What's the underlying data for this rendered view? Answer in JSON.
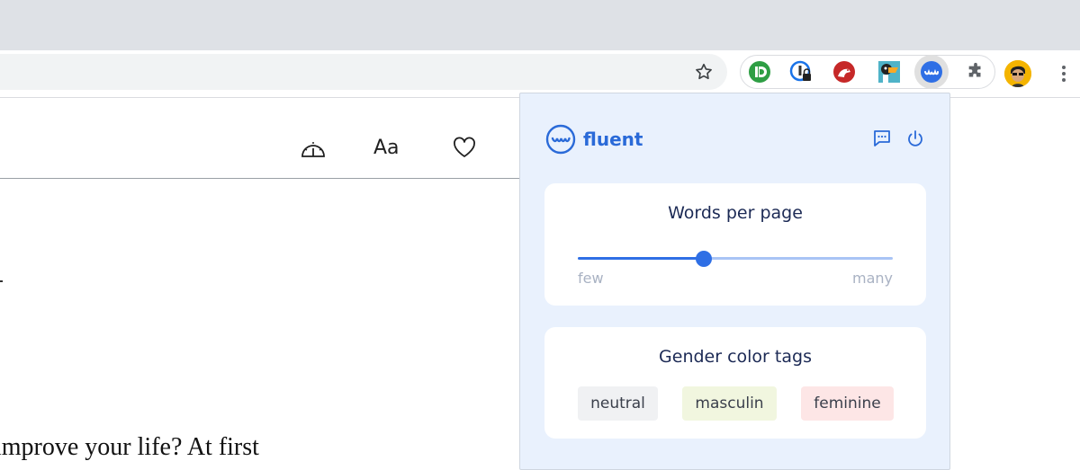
{
  "browser": {
    "extensions": [
      "pushbullet-icon",
      "onepassword-icon",
      "bird-extension-icon",
      "toucan-icon",
      "fluent-icon",
      "puzzle-icon"
    ]
  },
  "page": {
    "toolbar": {
      "font_label": "Aa"
    },
    "article_text": "improve your life? At first"
  },
  "popup": {
    "brand": "fluent",
    "words_per_page": {
      "title": "Words per page",
      "min_label": "few",
      "max_label": "many",
      "value": 0.4
    },
    "gender_tags": {
      "title": "Gender color tags",
      "tags": [
        {
          "label": "neutral",
          "color": "#f0f1f3"
        },
        {
          "label": "masculin",
          "color": "#f1f6df"
        },
        {
          "label": "feminine",
          "color": "#fde6e6"
        }
      ]
    },
    "colors": {
      "accent": "#2f6fe5",
      "popup_bg": "#e9f1fd"
    }
  }
}
